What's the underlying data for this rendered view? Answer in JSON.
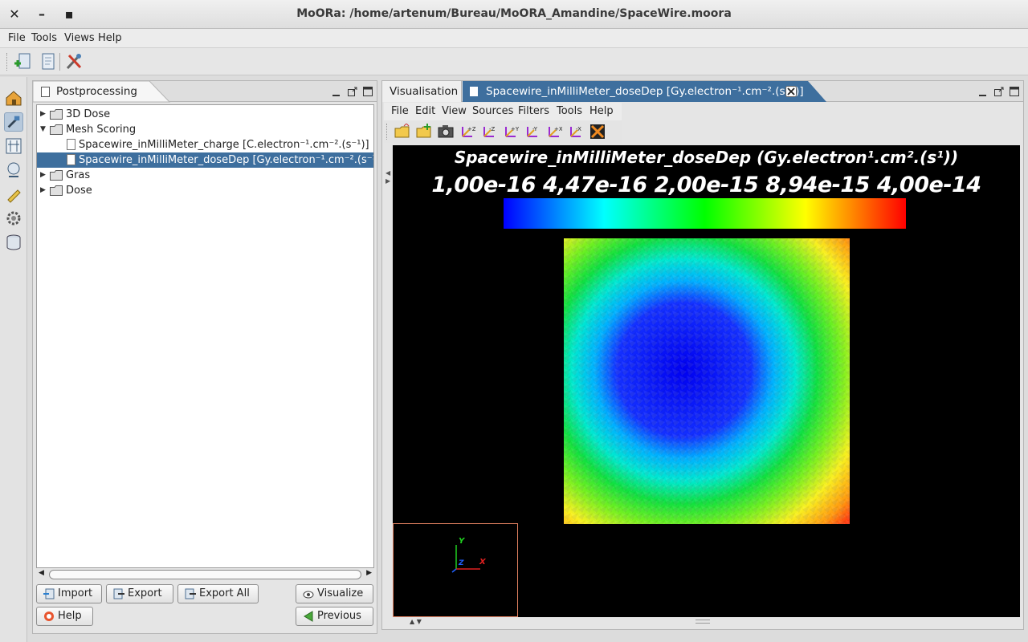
{
  "window": {
    "title": "MoORa: /home/artenum/Bureau/MoORA_Amandine/SpaceWire.moora",
    "close_glyph": "✕",
    "minimize_glyph": "–",
    "maximize_glyph": "▪"
  },
  "menubar": {
    "items": [
      "File",
      "Tools",
      "Views",
      "Help"
    ]
  },
  "main_toolbar": {
    "icons": [
      "import-project-icon",
      "open-document-icon",
      "tools-icon"
    ]
  },
  "left_sidebar": {
    "icons": [
      "home-icon",
      "build-icon",
      "mesh-icon",
      "probe-icon",
      "edit-icon",
      "settings-gear-icon",
      "database-icon"
    ],
    "active_index": 1
  },
  "postprocessing_panel": {
    "tab_label": "Postprocessing",
    "tree": [
      {
        "label": "3D Dose",
        "expanded": false
      },
      {
        "label": "Mesh Scoring",
        "expanded": true
      },
      {
        "label": "Spacewire_inMilliMeter_charge [C.electron⁻¹.cm⁻².(s⁻¹)]"
      },
      {
        "label": "Spacewire_inMilliMeter_doseDep [Gy.electron⁻¹.cm⁻².(s⁻¹)]",
        "selected": true
      },
      {
        "label": "Gras",
        "expanded": false
      },
      {
        "label": "Dose",
        "expanded": false
      }
    ],
    "buttons": {
      "import": "Import",
      "export": "Export",
      "export_all": "Export All",
      "visualize": "Visualize",
      "help": "Help",
      "previous": "Previous"
    }
  },
  "visualisation_panel": {
    "tabs": [
      {
        "label": "Visualisation",
        "active": false
      },
      {
        "label": "Spacewire_inMilliMeter_doseDep [Gy.electron⁻¹.cm⁻².(s⁻¹)]",
        "active": true,
        "closable": true
      }
    ],
    "menu": [
      "File",
      "Edit",
      "View",
      "Sources",
      "Filters",
      "Tools",
      "Help"
    ],
    "toolbar_icons": [
      "open-folder-icon",
      "add-folder-icon",
      "camera-icon",
      "view-plus-z-icon",
      "view-minus-z-icon",
      "view-plus-y-icon",
      "view-minus-y-icon",
      "view-plus-x-icon",
      "view-minus-x-icon",
      "fit-view-icon"
    ],
    "scene": {
      "title": "Spacewire_inMilliMeter_doseDep (Gy.electron¹.cm².(s¹))",
      "scale_ticks": [
        "1,00e-16",
        "4,47e-16",
        "2,00e-15",
        "8,94e-15",
        "4,00e-14"
      ],
      "colormap": [
        "#0000ff",
        "#00ffff",
        "#00ff00",
        "#ffff00",
        "#ff0000"
      ],
      "axes": {
        "x": "X",
        "y": "Y",
        "z": "Z"
      }
    }
  }
}
